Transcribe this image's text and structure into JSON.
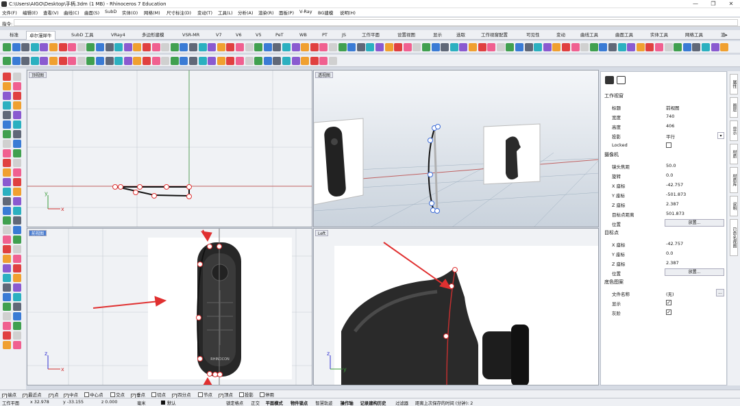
{
  "window": {
    "title": "C:\\Users\\AIGO\\Desktop\\手柄.3dm (1 MB) - Rhinoceros 7 Education",
    "minimize": "—",
    "maximize": "❐",
    "close": "✕"
  },
  "menu": [
    "文件(F)",
    "编辑(E)",
    "查看(V)",
    "曲线(C)",
    "曲面(S)",
    "SubD",
    "实体(O)",
    "网格(M)",
    "尺寸标注(D)",
    "变动(T)",
    "工具(L)",
    "分析(A)",
    "渲染(R)",
    "面板(P)",
    "V-Ray",
    "BG建模",
    "说明(H)"
  ],
  "command": {
    "label": "指令:",
    "value": ""
  },
  "tabs": [
    "标准",
    "卓尔漫犀牛",
    "SubD 工具",
    "VRay4",
    "多边形建模",
    "VSR-MR",
    "V7",
    "V6",
    "V5",
    "PeT",
    "WB",
    "PT",
    "JS",
    "工作平面",
    "设置视图",
    "显示",
    "选取",
    "工作视窗配置",
    "可见性",
    "变动",
    "曲线工具",
    "曲面工具",
    "实体工具",
    "网格工具",
    "渲▸"
  ],
  "active_tab": "卓尔漫犀牛",
  "viewports": {
    "top": "顶视图",
    "perspective": "透视图",
    "front": "前视图",
    "left": "Left"
  },
  "axes": {
    "x": "x",
    "y": "y",
    "z": "z"
  },
  "product_text": "RHINOCON",
  "panel": {
    "section_viewport": "工作视窗",
    "rows_viewport": [
      {
        "k": "标题",
        "v": "前视图"
      },
      {
        "k": "宽度",
        "v": "740"
      },
      {
        "k": "高度",
        "v": "406"
      },
      {
        "k": "投影",
        "v": "平行"
      },
      {
        "k": "Locked",
        "v": ""
      }
    ],
    "section_camera": "摄像机",
    "rows_camera": [
      {
        "k": "镜头焦距",
        "v": "50.0"
      },
      {
        "k": "旋转",
        "v": "0.0"
      },
      {
        "k": "X 座标",
        "v": "-42.757"
      },
      {
        "k": "Y 座标",
        "v": "-501.873"
      },
      {
        "k": "Z 座标",
        "v": "2.387"
      },
      {
        "k": "目标点距离",
        "v": "501.873"
      },
      {
        "k": "位置",
        "v": ""
      }
    ],
    "place_button": "放置...",
    "section_target": "目标点",
    "rows_target": [
      {
        "k": "X 座标",
        "v": "-42.757"
      },
      {
        "k": "Y 座标",
        "v": "0.0"
      },
      {
        "k": "Z 座标",
        "v": "2.387"
      },
      {
        "k": "位置",
        "v": ""
      }
    ],
    "section_wallpaper": "底色图案",
    "rows_wallpaper": [
      {
        "k": "文件名称",
        "v": "(无)"
      },
      {
        "k": "显示",
        "v": ""
      },
      {
        "k": "灰阶",
        "v": ""
      }
    ],
    "browse_button": "...",
    "check_mark": "✓"
  },
  "right_tabs": [
    "属性",
    "图层",
    "显示",
    "材质",
    "材质库",
    "说明",
    "已命名视图"
  ],
  "osnaps": [
    {
      "label": "端点",
      "on": true
    },
    {
      "label": "最近点",
      "on": true
    },
    {
      "label": "点",
      "on": true
    },
    {
      "label": "中点",
      "on": true
    },
    {
      "label": "中心点",
      "on": false
    },
    {
      "label": "交点",
      "on": false
    },
    {
      "label": "垂点",
      "on": true
    },
    {
      "label": "切点",
      "on": false
    },
    {
      "label": "四分点",
      "on": true
    },
    {
      "label": "节点",
      "on": false
    },
    {
      "label": "顶点",
      "on": true
    },
    {
      "label": "投影",
      "on": false
    },
    {
      "label": "停用",
      "on": false
    }
  ],
  "status": {
    "plane": "工作平面",
    "x": "x 32.978",
    "y": "y -33.155",
    "z": "z 0.000",
    "unit": "毫米",
    "layer": "默认",
    "items": [
      "锁定格点",
      "正交",
      "平面模式",
      "物件锁点",
      "智慧轨迹",
      "操作轴",
      "记录建构历史",
      "过滤器",
      "距离上次保存的时间 (分钟): 2"
    ]
  }
}
